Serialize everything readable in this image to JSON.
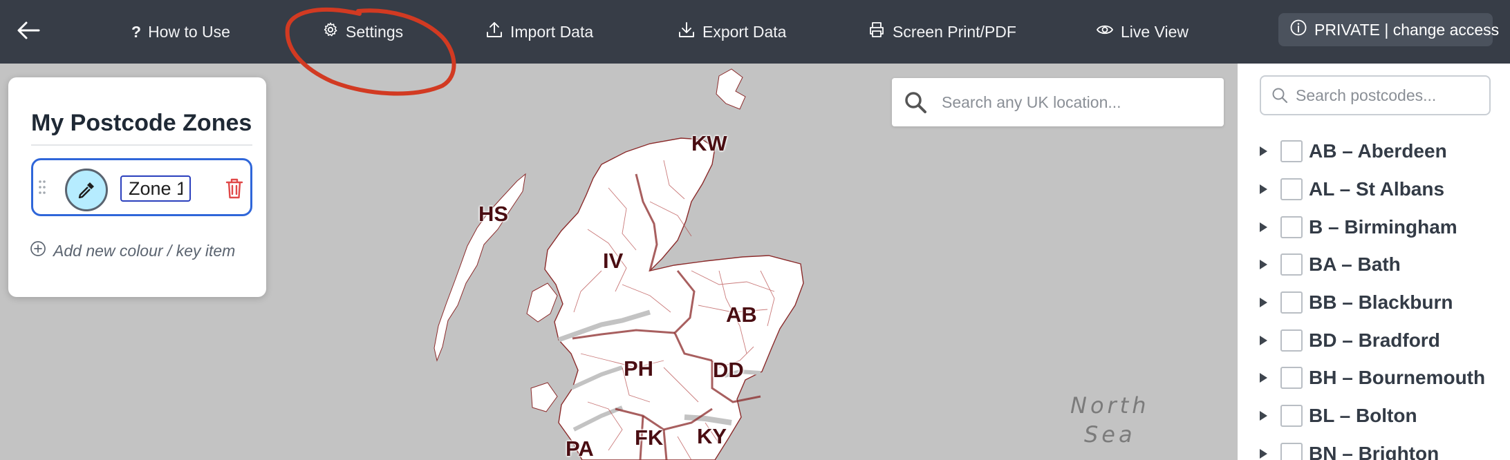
{
  "topbar": {
    "back_icon": "arrow-left-icon",
    "how_to_use": "How to Use",
    "settings": "Settings",
    "import_data": "Import Data",
    "export_data": "Export Data",
    "screen_print": "Screen Print/PDF",
    "live_view": "Live View",
    "access": "PRIVATE | change access",
    "annotation_color": "#d23a22"
  },
  "zones_panel": {
    "title": "My Postcode Zones",
    "zones": [
      {
        "name": "Zone 1",
        "color": "#b6ecff"
      }
    ],
    "add_item": "Add new colour / key item"
  },
  "map": {
    "search_placeholder": "Search any UK location...",
    "sea_label_line1": "North",
    "sea_label_line2": "Sea",
    "postcode_areas": [
      "KW",
      "HS",
      "IV",
      "AB",
      "PH",
      "DD",
      "PA",
      "FK",
      "KY"
    ],
    "boundary_color": "#8b2a2a",
    "land_color": "#ffffff",
    "water_color": "#c3c3c3"
  },
  "sidebar": {
    "search_placeholder": "Search postcodes...",
    "postcodes": [
      "AB – Aberdeen",
      "AL – St Albans",
      "B – Birmingham",
      "BA – Bath",
      "BB – Blackburn",
      "BD – Bradford",
      "BH – Bournemouth",
      "BL – Bolton",
      "BN – Brighton"
    ]
  }
}
